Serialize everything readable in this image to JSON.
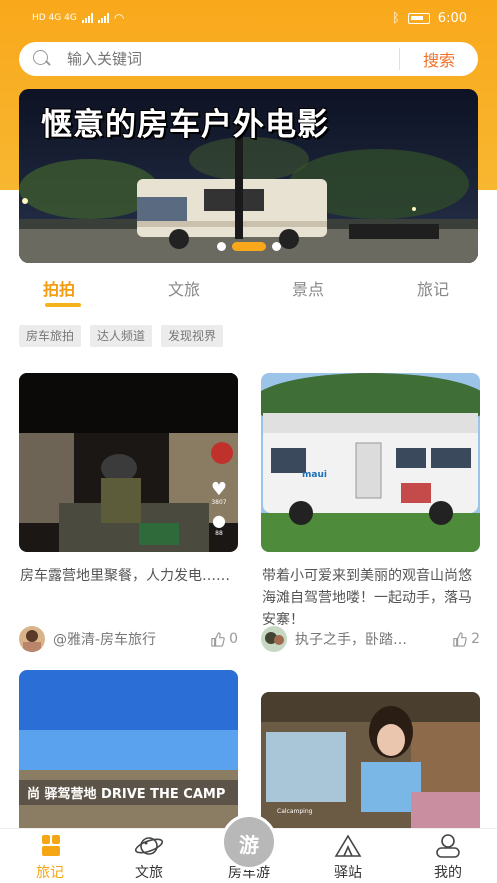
{
  "status_bar": {
    "left": "HD 4G 4G",
    "time": "6:00",
    "battery": "46"
  },
  "search": {
    "placeholder": "输入关键词",
    "button_label": "搜索"
  },
  "banner": {
    "title": "惬意的房车户外电影",
    "slide_count": 3,
    "active_slide": 1
  },
  "tabs": [
    {
      "label": "拍拍",
      "active": true
    },
    {
      "label": "文旅",
      "active": false
    },
    {
      "label": "景点",
      "active": false
    },
    {
      "label": "旅记",
      "active": false
    }
  ],
  "chips": [
    "房车旅拍",
    "达人频道",
    "发现视界"
  ],
  "cards": [
    {
      "text": "房车露营地里聚餐，人力发电……",
      "author": "@雅清-房车旅行",
      "likes": "0",
      "overlay_like_count": "3807",
      "overlay_comment_count": "88"
    },
    {
      "text": "带着小可爱来到美丽的观音山尚悠海滩自驾营地喽！一起动手，落马安寨！",
      "author": "执子之手，卧踏…",
      "likes": "2",
      "image_sign": "maui"
    },
    {
      "image_sign": "尚 驿驾营地 DRIVE THE CAMP"
    },
    {
      "image_sign": "Calcamping"
    }
  ],
  "bottom_nav": [
    {
      "label": "旅记",
      "icon": "journal-icon",
      "active": true
    },
    {
      "label": "文旅",
      "icon": "planet-icon",
      "active": false
    },
    {
      "label": "房车游",
      "icon": "rv-tour-icon",
      "active": false,
      "fab_text": "游"
    },
    {
      "label": "驿站",
      "icon": "tent-icon",
      "active": false
    },
    {
      "label": "我的",
      "icon": "profile-icon",
      "active": false
    }
  ],
  "colors": {
    "accent": "#f9a81b",
    "search_button": "#f0722a",
    "tab_active": "#f39c12"
  }
}
